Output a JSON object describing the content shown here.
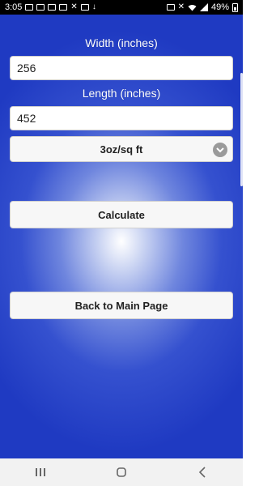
{
  "status_bar": {
    "time": "3:05",
    "battery_percent": "49%",
    "left_icons": [
      "chat-icon",
      "mail-icon",
      "mail-icon",
      "mail-icon",
      "missed-call-icon",
      "mail-icon",
      "download-icon"
    ],
    "right_icons": [
      "nfc-icon",
      "mute-icon",
      "wifi-icon",
      "signal-icon",
      "battery-icon"
    ]
  },
  "form": {
    "width_label": "Width (inches)",
    "width_value": "256",
    "length_label": "Length (inches)",
    "length_value": "452",
    "rate_selected": "3oz/sq ft"
  },
  "buttons": {
    "calculate": "Calculate",
    "back": "Back to Main Page"
  },
  "colors": {
    "background_edge": "#1f3ac2",
    "background_center": "#ffffff",
    "button_bg": "#f7f7f7"
  }
}
